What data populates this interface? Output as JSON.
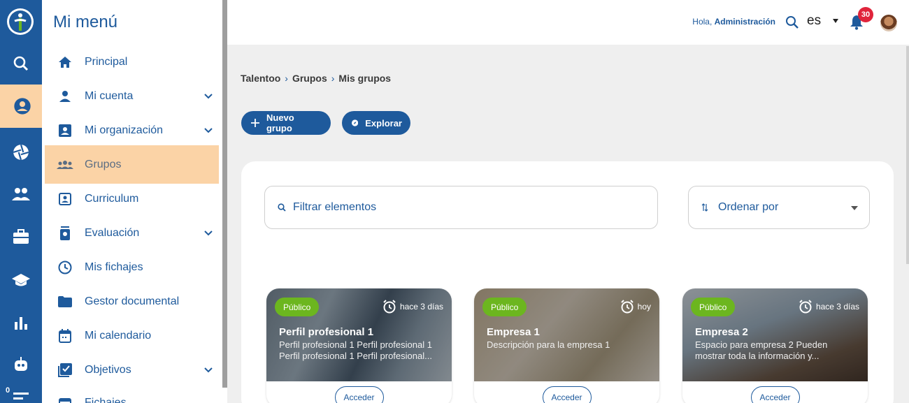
{
  "menu": {
    "title": "Mi menú",
    "items": [
      {
        "label": "Principal",
        "icon": "home-icon"
      },
      {
        "label": "Mi cuenta",
        "icon": "user-icon",
        "expandable": true
      },
      {
        "label": "Mi organización",
        "icon": "contact-card-icon",
        "expandable": true
      },
      {
        "label": "Grupos",
        "icon": "groups-icon",
        "active": true
      },
      {
        "label": "Curriculum",
        "icon": "resume-icon"
      },
      {
        "label": "Evaluación",
        "icon": "evaluation-icon",
        "expandable": true
      },
      {
        "label": "Mis fichajes",
        "icon": "clock-icon"
      },
      {
        "label": "Gestor documental",
        "icon": "folder-icon"
      },
      {
        "label": "Mi calendario",
        "icon": "calendar-icon"
      },
      {
        "label": "Objetivos",
        "icon": "checkbox-icon",
        "expandable": true
      },
      {
        "label": "Fichajes",
        "icon": "calendar-icon"
      }
    ]
  },
  "rail": {
    "icons": [
      "logo-icon",
      "search-icon",
      "account-circle-icon",
      "aperture-icon",
      "people-icon",
      "briefcase-icon",
      "school-icon",
      "bar-chart-icon",
      "robot-icon",
      "list-icon"
    ],
    "badge": "0"
  },
  "topbar": {
    "greeting_prefix": "Hola,",
    "user": "Administración",
    "language": "es",
    "notifications": "30"
  },
  "breadcrumb": [
    "Talentoo",
    "Grupos",
    "Mis grupos"
  ],
  "actions": {
    "new_group": "Nuevo grupo",
    "explore": "Explorar"
  },
  "filter": {
    "placeholder": "Filtrar elementos"
  },
  "sort": {
    "label": "Ordenar por"
  },
  "groups": [
    {
      "tag": "Público",
      "time": "hace 3 días",
      "title": "Perfil profesional 1",
      "description": "Perfil profesional 1 Perfil profesional 1 Perfil profesional 1 Perfil profesional...",
      "action": "Acceder"
    },
    {
      "tag": "Público",
      "time": "hoy",
      "title": "Empresa 1",
      "description": "Descripción para la empresa 1",
      "action": "Acceder"
    },
    {
      "tag": "Público",
      "time": "hace 3 días",
      "title": "Empresa 2",
      "description": "Espacio para empresa 2 Pueden mostrar toda la información y...",
      "action": "Acceder"
    }
  ],
  "colors": {
    "primary": "#1e5a9c",
    "active_highlight": "#fbd3a6",
    "tag_green": "#6cb61f",
    "badge_red": "#e0243b"
  }
}
